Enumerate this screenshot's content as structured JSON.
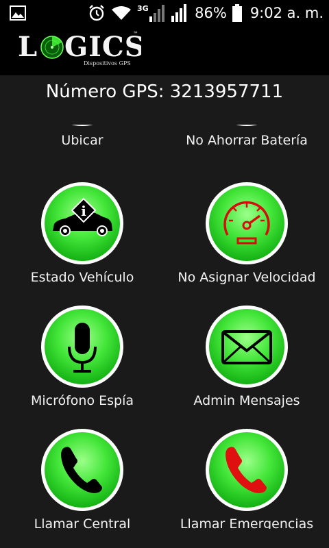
{
  "status_bar": {
    "battery": "86%",
    "time": "9:02 a. m.",
    "network": "3G",
    "icons": [
      "image-icon",
      "alarm-icon",
      "wifi-icon",
      "signal-3g-icon",
      "signal-icon",
      "battery-icon"
    ]
  },
  "app_bar": {
    "logo_text": "LOGICS",
    "logo_tm": "™",
    "logo_subtitle": "Dispositivos GPS"
  },
  "gps_number": "Número GPS: 3213957711",
  "actions": [
    {
      "label": "Ubicar",
      "icon": "location-icon"
    },
    {
      "label": "No Ahorrar Batería",
      "icon": "battery-saver-icon"
    },
    {
      "label": "Estado Vehículo",
      "icon": "car-info-icon"
    },
    {
      "label": "No Asignar Velocidad",
      "icon": "speedometer-icon"
    },
    {
      "label": "Micrófono Espía",
      "icon": "microphone-icon"
    },
    {
      "label": "Admin Mensajes",
      "icon": "envelope-icon"
    },
    {
      "label": "Llamar Central",
      "icon": "phone-black-icon"
    },
    {
      "label": "Llamar Emergencias",
      "icon": "phone-red-icon"
    }
  ],
  "colors": {
    "background": "#1a1a1a",
    "button_green": "#2fd62a",
    "accent_red": "#e01010"
  }
}
